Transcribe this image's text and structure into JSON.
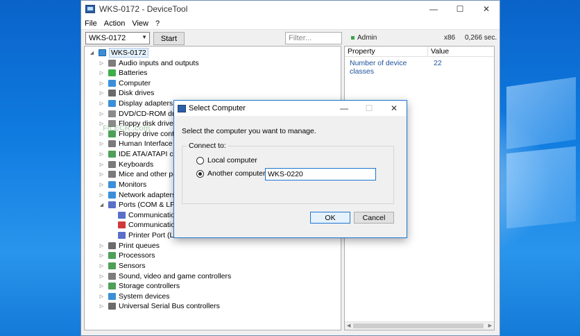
{
  "window": {
    "title": "WKS-0172 - DeviceTool",
    "controls": {
      "minimize": "—",
      "maximize": "☐",
      "close": "✕"
    }
  },
  "menu": [
    "File",
    "Action",
    "View",
    "?"
  ],
  "toolbar": {
    "computer_value": "WKS-0172",
    "start_label": "Start",
    "filter_placeholder": "Filter...",
    "admin_label": "Admin",
    "arch": "x86",
    "timing": "0,266 sec."
  },
  "tree": {
    "root": "WKS-0172",
    "items": [
      {
        "label": "Audio inputs and outputs",
        "expanded": false,
        "color": "#7d7d7d"
      },
      {
        "label": "Batteries",
        "expanded": false,
        "color": "#3fae49"
      },
      {
        "label": "Computer",
        "expanded": false,
        "color": "#3b8fd9"
      },
      {
        "label": "Disk drives",
        "expanded": false,
        "color": "#6b6b6b"
      },
      {
        "label": "Display adapters",
        "expanded": false,
        "color": "#3b8fd9"
      },
      {
        "label": "DVD/CD-ROM drive",
        "expanded": false,
        "color": "#8a8a8a"
      },
      {
        "label": "Floppy disk drives",
        "expanded": false,
        "color": "#8a8a8a"
      },
      {
        "label": "Floppy drive contro",
        "expanded": false,
        "color": "#4f9f58"
      },
      {
        "label": "Human Interface De",
        "expanded": false,
        "color": "#7a7a7a"
      },
      {
        "label": "IDE ATA/ATAPI contr",
        "expanded": false,
        "color": "#4f9f58"
      },
      {
        "label": "Keyboards",
        "expanded": false,
        "color": "#7a7a7a"
      },
      {
        "label": "Mice and other poir",
        "expanded": false,
        "color": "#7a7a7a"
      },
      {
        "label": "Monitors",
        "expanded": false,
        "color": "#3b8fd9"
      },
      {
        "label": "Network adapters",
        "expanded": false,
        "color": "#3b8fd9"
      },
      {
        "label": "Ports (COM & LPT)",
        "expanded": true,
        "color": "#5a6fc8",
        "children": [
          {
            "label": "Communication",
            "color": "#5a6fc8"
          },
          {
            "label": "Communication",
            "color": "#d03a3a"
          },
          {
            "label": "Printer Port (LPT",
            "color": "#5a6fc8"
          }
        ]
      },
      {
        "label": "Print queues",
        "expanded": false,
        "color": "#6b6b6b"
      },
      {
        "label": "Processors",
        "expanded": false,
        "color": "#4f9f58"
      },
      {
        "label": "Sensors",
        "expanded": false,
        "color": "#4f9f58"
      },
      {
        "label": "Sound, video and game controllers",
        "expanded": false,
        "color": "#7d7d7d"
      },
      {
        "label": "Storage controllers",
        "expanded": false,
        "color": "#4f9f58"
      },
      {
        "label": "System devices",
        "expanded": false,
        "color": "#3b8fd9"
      },
      {
        "label": "Universal Serial Bus controllers",
        "expanded": false,
        "color": "#6b6b6b"
      }
    ]
  },
  "properties": {
    "headers": {
      "property": "Property",
      "value": "Value"
    },
    "rows": [
      {
        "name": "Number of device classes",
        "value": "22"
      }
    ]
  },
  "watermark": "FILECR .com",
  "dialog": {
    "title": "Select Computer",
    "prompt": "Select the computer you want to manage.",
    "group_label": "Connect to:",
    "local_label": "Local computer",
    "another_label": "Another computer:",
    "computer_name": "WKS-0220",
    "selected_option": "another",
    "ok_label": "OK",
    "cancel_label": "Cancel",
    "controls": {
      "minimize": "—",
      "maximize": "☐",
      "close": "✕"
    }
  }
}
